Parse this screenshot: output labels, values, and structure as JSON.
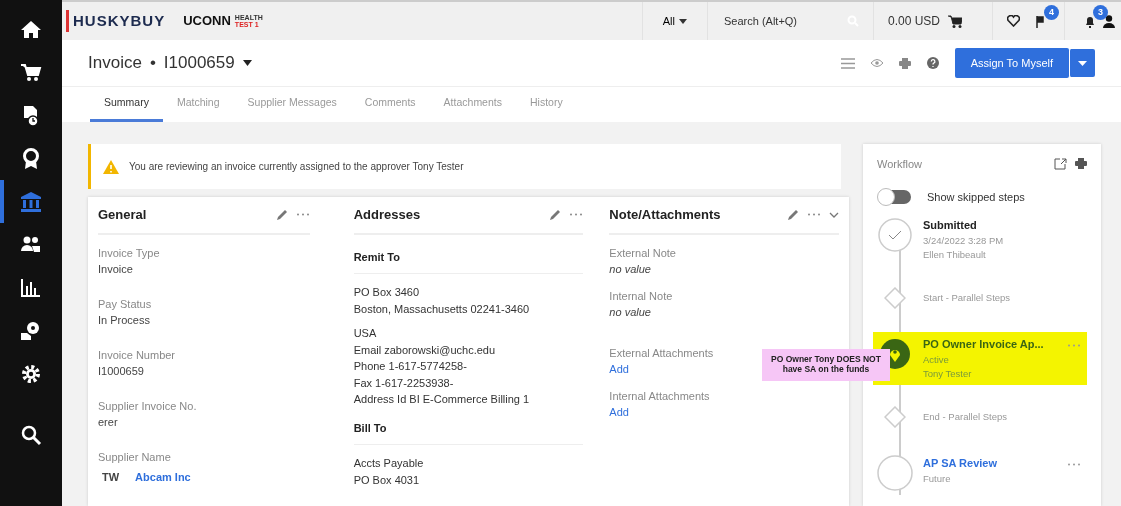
{
  "sidebar": {
    "items": [
      {
        "selected": false
      },
      {
        "selected": false
      },
      {
        "selected": false
      },
      {
        "selected": false
      },
      {
        "selected": true
      },
      {
        "selected": false
      },
      {
        "selected": false
      },
      {
        "selected": false
      },
      {
        "selected": false
      },
      {
        "selected": false
      }
    ]
  },
  "topbar": {
    "logo": "HUSKYBUY",
    "org": "UCONN",
    "org_sub": "HEALTH",
    "env": "TEST 1",
    "scope": "All",
    "search": {
      "placeholder": "Search (Alt+Q)"
    },
    "cart_total": "0.00 USD",
    "flag_badge": "4",
    "bell_badge": "3"
  },
  "header": {
    "title": "Invoice",
    "separator": "•",
    "number": "I1000659",
    "primary_button": "Assign To Myself"
  },
  "tabs": [
    {
      "label": "Summary",
      "selected": true
    },
    {
      "label": "Matching",
      "selected": false
    },
    {
      "label": "Supplier Messages",
      "selected": false
    },
    {
      "label": "Comments",
      "selected": false
    },
    {
      "label": "Attachments",
      "selected": false
    },
    {
      "label": "History",
      "selected": false
    }
  ],
  "alert": "You are reviewing an invoice currently assigned to the approver Tony Tester",
  "general": {
    "title": "General",
    "fields": [
      {
        "label": "Invoice Type",
        "value": "Invoice"
      },
      {
        "label": "Pay Status",
        "value": "In Process"
      },
      {
        "label": "Invoice Number",
        "value": "I1000659"
      },
      {
        "label": "Supplier Invoice No.",
        "value": "erer"
      },
      {
        "label": "Supplier Name",
        "initials": "TW",
        "link": "Abcam Inc"
      }
    ]
  },
  "addresses": {
    "title": "Addresses",
    "sections": [
      {
        "heading": "Remit To",
        "blocks": [
          [
            "PO Box 3460",
            "Boston, Massachusetts 02241-3460"
          ],
          [
            "USA",
            "Email zaborowski@uchc.edu",
            "Phone 1-617-5774258-",
            "Fax 1-617-2253938-",
            "Address Id BI E-Commerce Billing 1"
          ]
        ]
      },
      {
        "heading": "Bill To",
        "blocks": [
          [
            "Accts Payable",
            "PO Box 4031"
          ]
        ]
      }
    ]
  },
  "notes": {
    "title": "Note/Attachments",
    "fields": [
      {
        "label": "External Note",
        "value": "no value",
        "kind": "empty"
      },
      {
        "label": "Internal Note",
        "value": "no value",
        "kind": "empty"
      },
      {
        "label": "External Attachments",
        "value": "Add",
        "kind": "link"
      },
      {
        "label": "Internal Attachments",
        "value": "Add",
        "kind": "link"
      }
    ]
  },
  "callout": "PO Owner Tony DOES NOT have SA on the funds",
  "workflow": {
    "title": "Workflow",
    "toggle": {
      "label": "Show skipped steps",
      "on": false
    },
    "steps": [
      {
        "kind": "done",
        "title": "Submitted",
        "lines": [
          "3/24/2022 3:28 PM",
          "Ellen Thibeault"
        ],
        "highlighted": false
      },
      {
        "kind": "gate",
        "title": "Start - Parallel Steps",
        "highlighted": false
      },
      {
        "kind": "active",
        "title": "PO Owner Invoice Ap...",
        "lines": [
          "Active",
          "Tony Tester"
        ],
        "highlighted": true
      },
      {
        "kind": "gate",
        "title": "End - Parallel Steps",
        "highlighted": false
      },
      {
        "kind": "future",
        "title": "AP SA Review",
        "lines": [
          "Future"
        ],
        "highlighted": false
      }
    ]
  }
}
